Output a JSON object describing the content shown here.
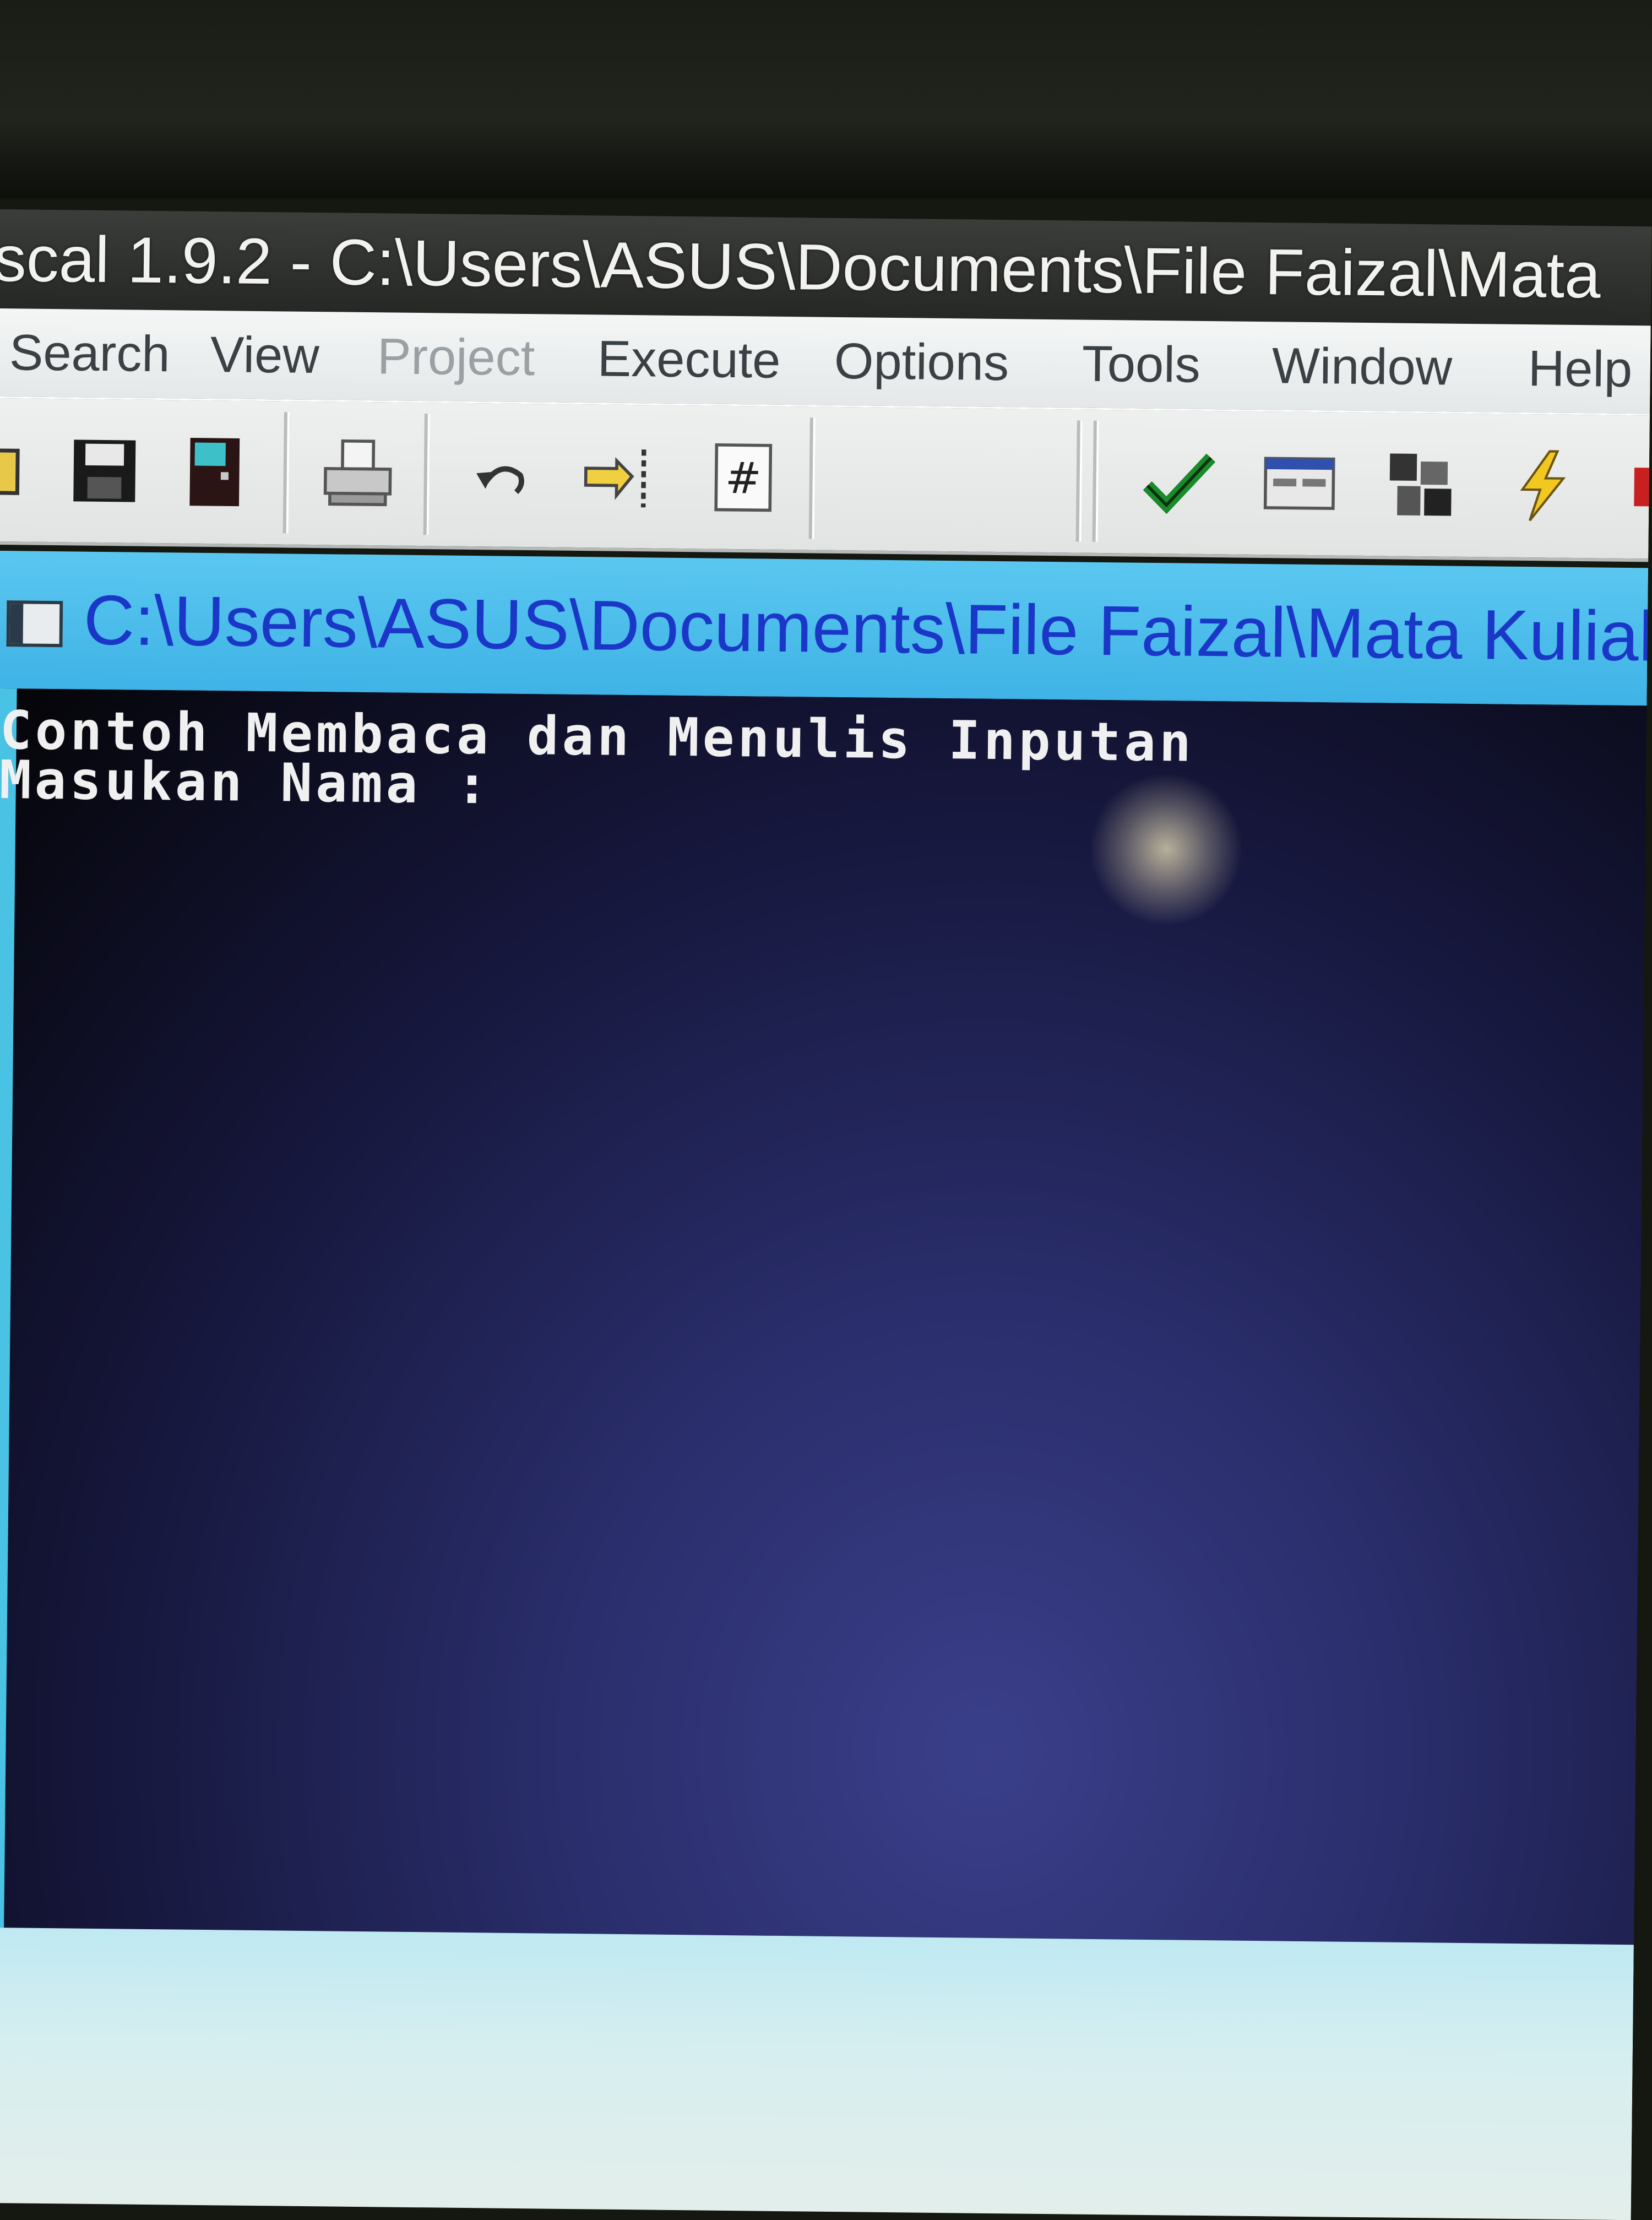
{
  "window": {
    "title": "scal 1.9.2 - C:\\Users\\ASUS\\Documents\\File Faizal\\Mata"
  },
  "menu": {
    "items": [
      {
        "label": "Search",
        "enabled": true
      },
      {
        "label": "View",
        "enabled": true
      },
      {
        "label": "Project",
        "enabled": false
      },
      {
        "label": "Execute",
        "enabled": true
      },
      {
        "label": "Options",
        "enabled": true
      },
      {
        "label": "Tools",
        "enabled": true
      },
      {
        "label": "Window",
        "enabled": true
      },
      {
        "label": "Help",
        "enabled": true
      }
    ]
  },
  "toolbar": {
    "buttons": [
      {
        "icon": "save-icon"
      },
      {
        "icon": "close-file-icon"
      },
      {
        "icon": "print-icon"
      },
      {
        "icon": "undo-icon"
      },
      {
        "icon": "goto-icon"
      },
      {
        "icon": "line-number-icon"
      },
      {
        "icon": "compile-check-icon"
      },
      {
        "icon": "run-window-icon"
      },
      {
        "icon": "debug-icon"
      },
      {
        "icon": "rebuild-lightning-icon"
      }
    ]
  },
  "document_tab": {
    "title": "C:\\Users\\ASUS\\Documents\\File Faizal\\Mata Kuliah\\Alg"
  },
  "console": {
    "lines": [
      "Contoh Membaca dan Menulis Inputan",
      "Masukan Nama :"
    ]
  },
  "colors": {
    "tab_background": "#3fb3e6",
    "tab_text": "#1a37c8",
    "console_background": "#1a1c48",
    "console_text": "#f0f0f0"
  }
}
